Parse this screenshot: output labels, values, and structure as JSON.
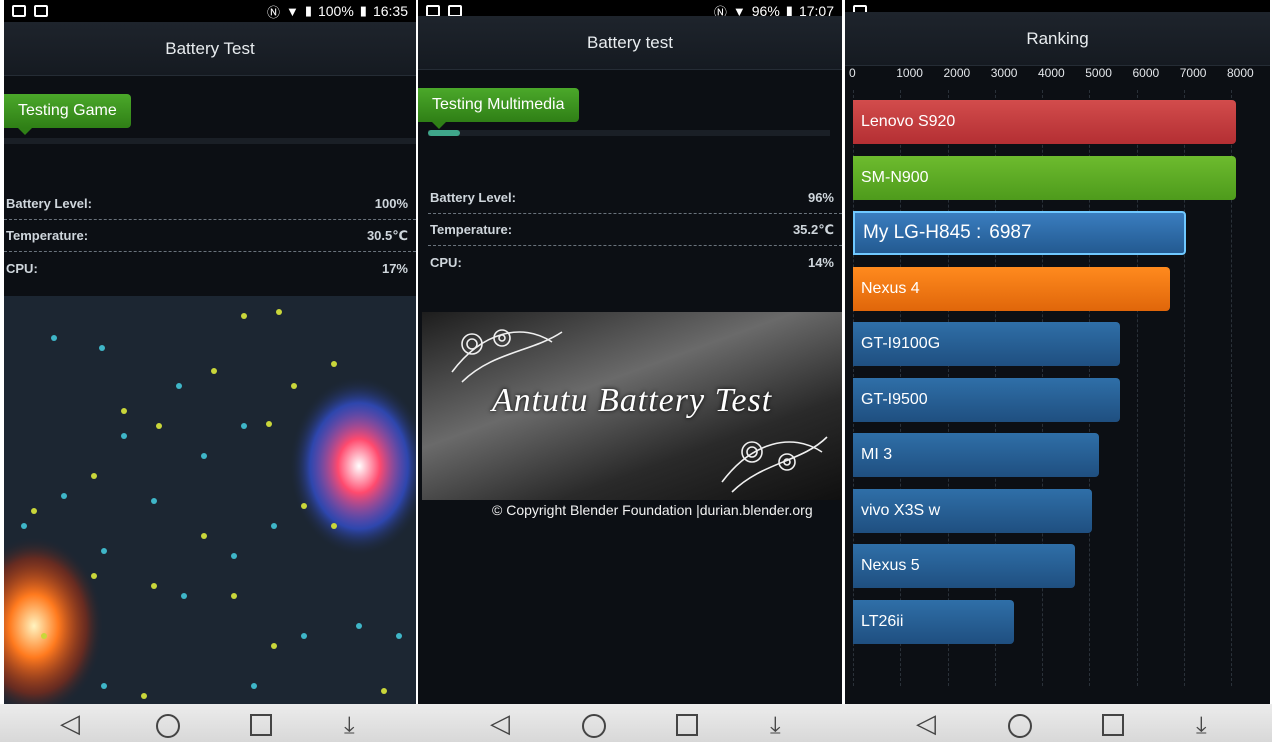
{
  "statusbar": {
    "battery": "100%",
    "time": "16:35",
    "battery_p2": "96%",
    "time_p2": "17:07"
  },
  "panel1": {
    "title": "Battery Test",
    "test_label": "Testing Game",
    "stats": [
      {
        "label": "Battery Level:",
        "value": "100%"
      },
      {
        "label": "Temperature:",
        "value": "30.5℃"
      },
      {
        "label": "CPU:",
        "value": "17%"
      }
    ]
  },
  "panel2": {
    "title": "Battery test",
    "test_label": "Testing Multimedia",
    "progress": 0.08,
    "stats": [
      {
        "label": "Battery Level:",
        "value": "96%"
      },
      {
        "label": "Temperature:",
        "value": "35.2℃"
      },
      {
        "label": "CPU:",
        "value": "14%"
      }
    ],
    "video_title": "Antutu Battery Test",
    "copyright": "© Copyright Blender Foundation |durian.blender.org"
  },
  "panel3": {
    "title": "Ranking",
    "chart_data": {
      "type": "bar",
      "orientation": "horizontal",
      "xlim": [
        0,
        8000
      ],
      "ticks": [
        "0",
        "1000",
        "2000",
        "3000",
        "4000",
        "5000",
        "6000",
        "7000",
        "8000"
      ],
      "categories": [
        "Lenovo S920",
        "SM-N900",
        "My LG-H845 :",
        "Nexus 4",
        "GT-I9100G",
        "GT-I9500",
        "MI 3",
        "vivo X3S w",
        "Nexus 5",
        "LT26ii"
      ],
      "values": [
        8100,
        8100,
        7050,
        6700,
        5650,
        5650,
        5200,
        5050,
        4700,
        3400
      ],
      "highlight_score": "6987",
      "colors": [
        "#c43a3d",
        "#5aa823",
        "#2e6fae",
        "#f07a12",
        "#28609a",
        "#28609a",
        "#28609a",
        "#28609a",
        "#28609a",
        "#28609a"
      ]
    }
  },
  "navbar": {
    "back": "◁",
    "down": "⤓"
  }
}
